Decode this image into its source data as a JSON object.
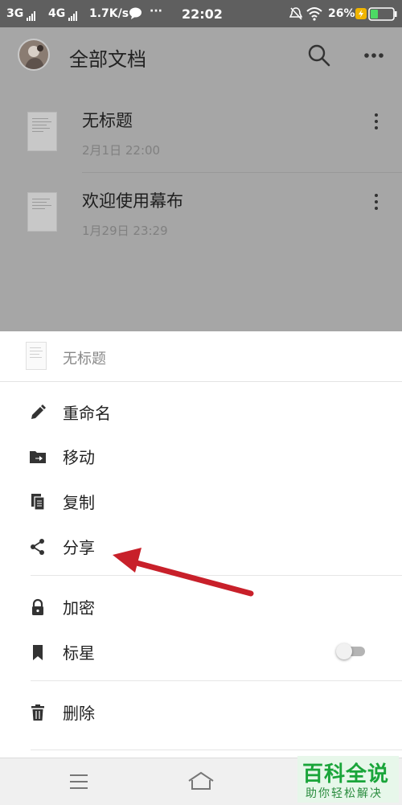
{
  "status_bar": {
    "network1": "3G",
    "network2": "4G",
    "speed": "1.7K/s",
    "more": "···",
    "time": "22:02",
    "battery": "26%",
    "icons": [
      "signal-bars-icon",
      "chat-bubble-icon",
      "mute-icon",
      "wifi-icon",
      "charge-icon",
      "battery-icon"
    ]
  },
  "header": {
    "title": "全部文档",
    "icons": [
      "avatar",
      "search-icon",
      "more-horizontal-icon"
    ]
  },
  "documents": [
    {
      "title": "无标题",
      "date": "2月1日 22:00"
    },
    {
      "title": "欢迎使用幕布",
      "date": "1月29日 23:29"
    }
  ],
  "sheet": {
    "doc_title": "无标题",
    "items": [
      {
        "label": "重命名",
        "icon": "pencil-icon"
      },
      {
        "label": "移动",
        "icon": "folder-move-icon"
      },
      {
        "label": "复制",
        "icon": "copy-icon"
      },
      {
        "label": "分享",
        "icon": "share-icon"
      },
      {
        "label": "加密",
        "icon": "lock-icon"
      },
      {
        "label": "标星",
        "icon": "bookmark-icon",
        "toggle_on": false
      },
      {
        "label": "删除",
        "icon": "trash-icon"
      }
    ]
  },
  "annotation": {
    "color": "#c8202a"
  },
  "navbar": {
    "icons": [
      "menu-icon",
      "home-icon"
    ]
  },
  "watermark": {
    "title": "百科全说",
    "subtitle": "助你轻松解决"
  },
  "colors": {
    "dim_overlay": "#a6a6a6",
    "status_bar": "#5f5f5f",
    "watermark_green": "#1aa53a"
  }
}
